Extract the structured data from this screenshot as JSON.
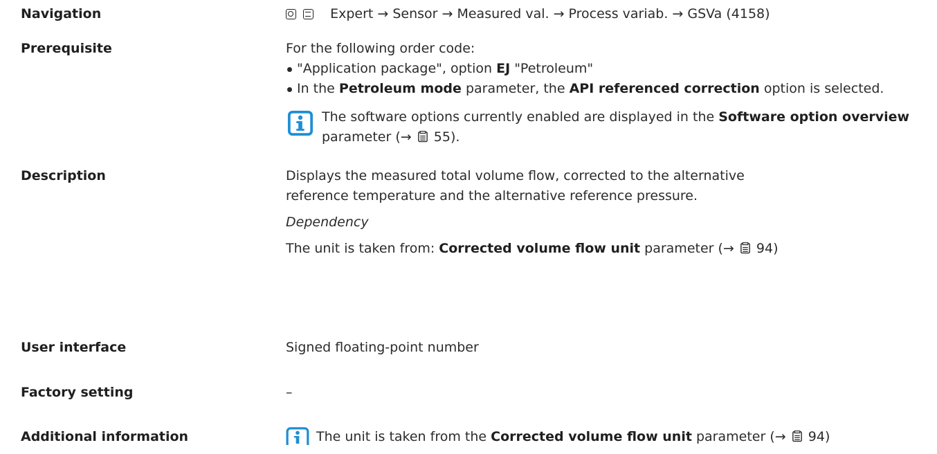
{
  "navigation": {
    "label": "Navigation",
    "path": "Expert → Sensor → Measured val. → Process variab. → GSVa (4158)"
  },
  "prerequisite": {
    "label": "Prerequisite",
    "intro": "For the following order code:",
    "bullet1_a": "\"Application package\", option ",
    "bullet1_b": "EJ",
    "bullet1_c": " \"Petroleum\"",
    "bullet2_a": "In the ",
    "bullet2_b": "Petroleum mode",
    "bullet2_c": " parameter, the ",
    "bullet2_d": "API referenced correction",
    "bullet2_e": " option is selected.",
    "note_a": "The software options currently enabled are displayed in the ",
    "note_b": "Software option overview",
    "note_c": " parameter (→ ",
    "note_page": "55",
    "note_d": ")."
  },
  "description": {
    "label": "Description",
    "text": "Displays the measured total volume flow, corrected to the alternative reference temperature and the alternative reference pressure.",
    "dependency_heading": "Dependency",
    "dep_a": "The unit is taken from: ",
    "dep_b": "Corrected volume flow unit",
    "dep_c": " parameter (→ ",
    "dep_page": "94",
    "dep_d": ")"
  },
  "user_interface": {
    "label": "User interface",
    "value": "Signed floating-point number"
  },
  "factory_setting": {
    "label": "Factory setting",
    "value": "–"
  },
  "additional_information": {
    "label": "Additional information",
    "text_a": "The unit is taken from the ",
    "text_b": "Corrected volume flow unit",
    "text_c": " parameter (→ ",
    "page": "94",
    "text_d": ")"
  },
  "icons": {
    "nav": [
      "operating-menu-icon",
      "display-icon"
    ],
    "info": "info-icon",
    "page": "page-reference-icon",
    "accent_color": "#1e8fd6"
  }
}
